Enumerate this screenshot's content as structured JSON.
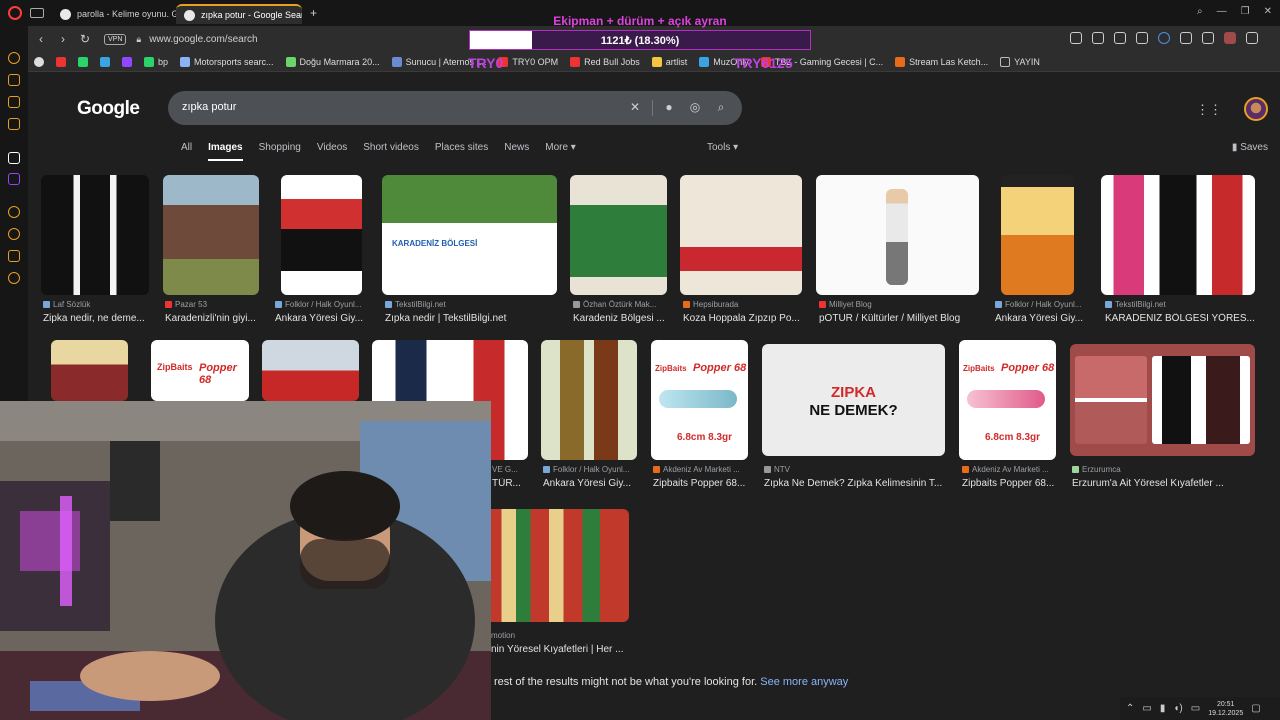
{
  "browser": {
    "tabs": [
      {
        "label": "parolla - Kelime oyunu. G",
        "active": false
      },
      {
        "label": "zıpka potur - Google Sear",
        "active": true
      }
    ],
    "new_tab": "+",
    "url": "www.google.com/search",
    "vpn": "VPN",
    "bookmarks": [
      {
        "label": "bp",
        "color": "#2bd46b"
      },
      {
        "label": "Motorsports searc...",
        "color": "#8ab4f8"
      },
      {
        "label": "Doğu Marmara 20...",
        "color": "#6bd46b"
      },
      {
        "label": "Sunucu | Aternos |...",
        "color": "#6a8bd4"
      },
      {
        "label": "TRY0 OPM",
        "color": "#e33"
      },
      {
        "label": "Red Bull Jobs",
        "color": "#e33"
      },
      {
        "label": "artlist",
        "color": "#f5c542"
      },
      {
        "label": "MuzOnly",
        "color": "#3aa3e3"
      },
      {
        "label": "TBZ - Gaming Gecesi | C...",
        "color": "#e33"
      },
      {
        "label": "Stream Las Ketch...",
        "color": "#e86a1b"
      },
      {
        "label": "YAYIN",
        "color": "#bbb"
      }
    ]
  },
  "overlay": {
    "title": "Ekipman + dürüm + açık ayran",
    "progress_text": "1121₺ (18.30%)",
    "progress": 0.183,
    "tag_left": "TRY0",
    "tag_right": "TRY6125"
  },
  "google": {
    "logo": "Google",
    "query": "zıpka potur",
    "tabs": [
      "All",
      "Images",
      "Shopping",
      "Videos",
      "Short videos",
      "Places sites",
      "News",
      "More ▾"
    ],
    "selected_tab": "Images",
    "tools": "Tools ▾",
    "saves": "Saves",
    "results_row1": [
      {
        "source": "Laf Sözlük",
        "caption": "Zipka nedir, ne deme..."
      },
      {
        "source": "Pazar 53",
        "caption": "Karadenizli'nin giyi..."
      },
      {
        "source": "Folklor / Halk Oyunl...",
        "caption": "Ankara Yöresi Giy..."
      },
      {
        "source": "TekstilBilgi.net",
        "caption": "Zıpka nedir | TekstilBilgi.net"
      },
      {
        "source": "Özhan Öztürk Mak...",
        "caption": "Karadeniz Bölgesi ..."
      },
      {
        "source": "Hepsiburada",
        "caption": "Koza Hoppala Zıpzıp Po..."
      },
      {
        "source": "Milliyet Blog",
        "caption": "pOTUR / Kültürler / Milliyet Blog"
      },
      {
        "source": "Folklor / Halk Oyunl...",
        "caption": "Ankara Yöresi Giy..."
      },
      {
        "source": "TekstilBilgi.net",
        "caption": "KARADENİZ BÖLGESİ YÖRES..."
      }
    ],
    "results_row2": [
      {
        "source": "VE G...",
        "caption": "TÜR..."
      },
      {
        "source": "Folklor / Halk Oyunl...",
        "caption": "Ankara Yöresi Giy..."
      },
      {
        "source": "Akdeniz Av Marketi ...",
        "caption": "Zipbaits Popper 68..."
      },
      {
        "source": "NTV",
        "caption": "Zıpka Ne Demek? Zıpka Kelimesinin T..."
      },
      {
        "source": "Akdeniz Av Marketi ...",
        "caption": "Zipbaits Popper 68..."
      },
      {
        "source": "Erzurumca",
        "caption": "Erzurum'a Ait Yöresel Kıyafetler ..."
      }
    ],
    "results_row3": [
      {
        "source": "motion",
        "caption": "nin Yöresel Kıyafetleri | Her ..."
      }
    ],
    "thumb_texts": {
      "karadeniz": "KARADENİZ BÖLGESİ",
      "zipka_title": "ZIPKA",
      "zipka_sub": "NE DEMEK?",
      "popper": "Popper 68",
      "zipbaits": "ZipBaits",
      "size": "6.8cm  8.3gr"
    },
    "notice_text": "rest of the results might not be what you're looking for.",
    "notice_link": "See more anyway"
  },
  "tray": {
    "time": "20:51",
    "date": "19.12.2025"
  }
}
